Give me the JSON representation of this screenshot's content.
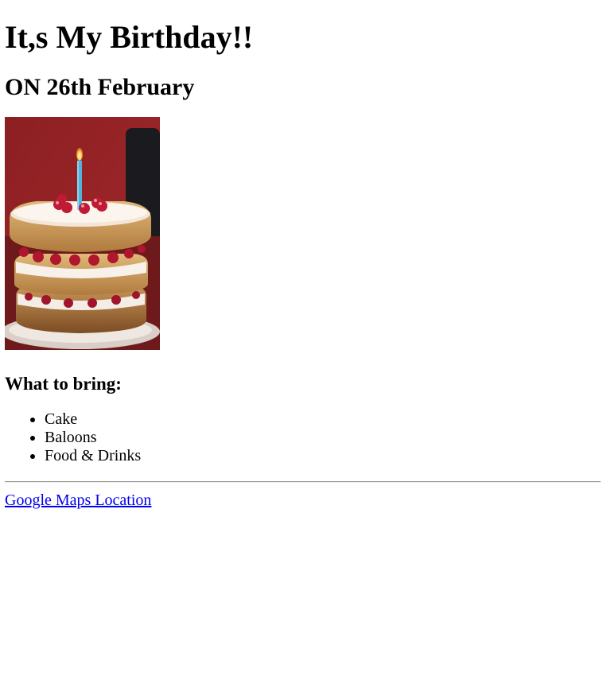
{
  "page": {
    "title": "It,s My Birthday!!",
    "subtitle": "ON 26th February"
  },
  "image": {
    "alt": "Birthday cake with candle"
  },
  "bring": {
    "heading": "What to bring:",
    "items": [
      "Cake",
      "Baloons",
      "Food & Drinks"
    ]
  },
  "footer": {
    "link_text": "Google Maps Location"
  },
  "colors": {
    "link": "#0000ee",
    "text": "#000000"
  }
}
